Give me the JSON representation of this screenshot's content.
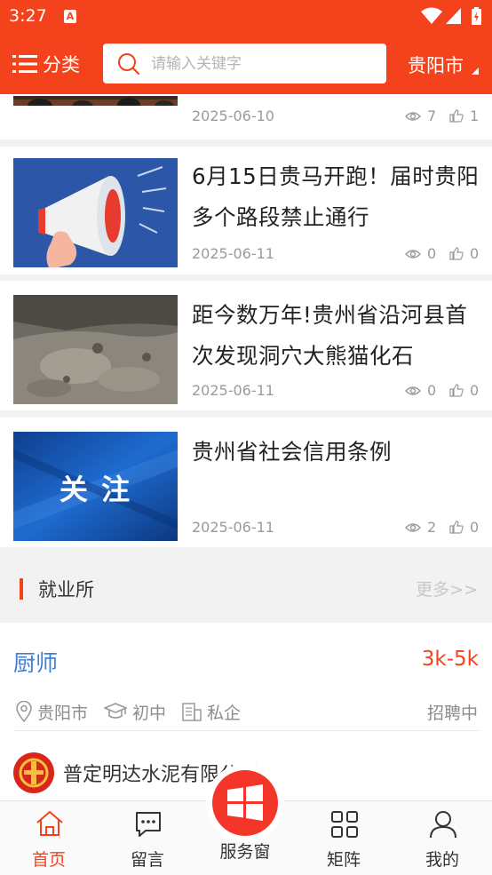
{
  "status_bar": {
    "time": "3:27",
    "notif_icon": "A"
  },
  "header": {
    "category_label": "分类",
    "search_placeholder": "请输入关键字",
    "city": "贵阳市"
  },
  "news": [
    {
      "title": "",
      "date": "2025-06-10",
      "views": "7",
      "likes": "1",
      "thumb": "meeting-photo"
    },
    {
      "title": "6月15日贵马开跑！届时贵阳多个路段禁止通行",
      "date": "2025-06-11",
      "views": "0",
      "likes": "0",
      "thumb": "megaphone-graphic"
    },
    {
      "title": "距今数万年!贵州省沿河县首次发现洞穴大熊猫化石",
      "date": "2025-06-11",
      "views": "0",
      "likes": "0",
      "thumb": "cave-fossil-photo"
    },
    {
      "title": "贵州省社会信用条例",
      "date": "2025-06-11",
      "views": "2",
      "likes": "0",
      "thumb": "attention-banner",
      "thumb_text": "关 注"
    }
  ],
  "section": {
    "title": "就业所",
    "more": "更多>>"
  },
  "job": {
    "title": "厨师",
    "salary": "3k-5k",
    "location": "贵阳市",
    "education": "初中",
    "company_type": "私企",
    "status": "招聘中",
    "company": "普定明达水泥有限公司"
  },
  "tabs": [
    {
      "label": "首页",
      "icon": "home-icon",
      "active": true
    },
    {
      "label": "留言",
      "icon": "message-icon",
      "active": false
    },
    {
      "label": "服务窗",
      "icon": "windows-icon",
      "active": false
    },
    {
      "label": "矩阵",
      "icon": "grid-icon",
      "active": false
    },
    {
      "label": "我的",
      "icon": "user-icon",
      "active": false
    }
  ],
  "colors": {
    "brand": "#f4431c",
    "link": "#3d7ed6",
    "muted": "#9a9a9a"
  }
}
